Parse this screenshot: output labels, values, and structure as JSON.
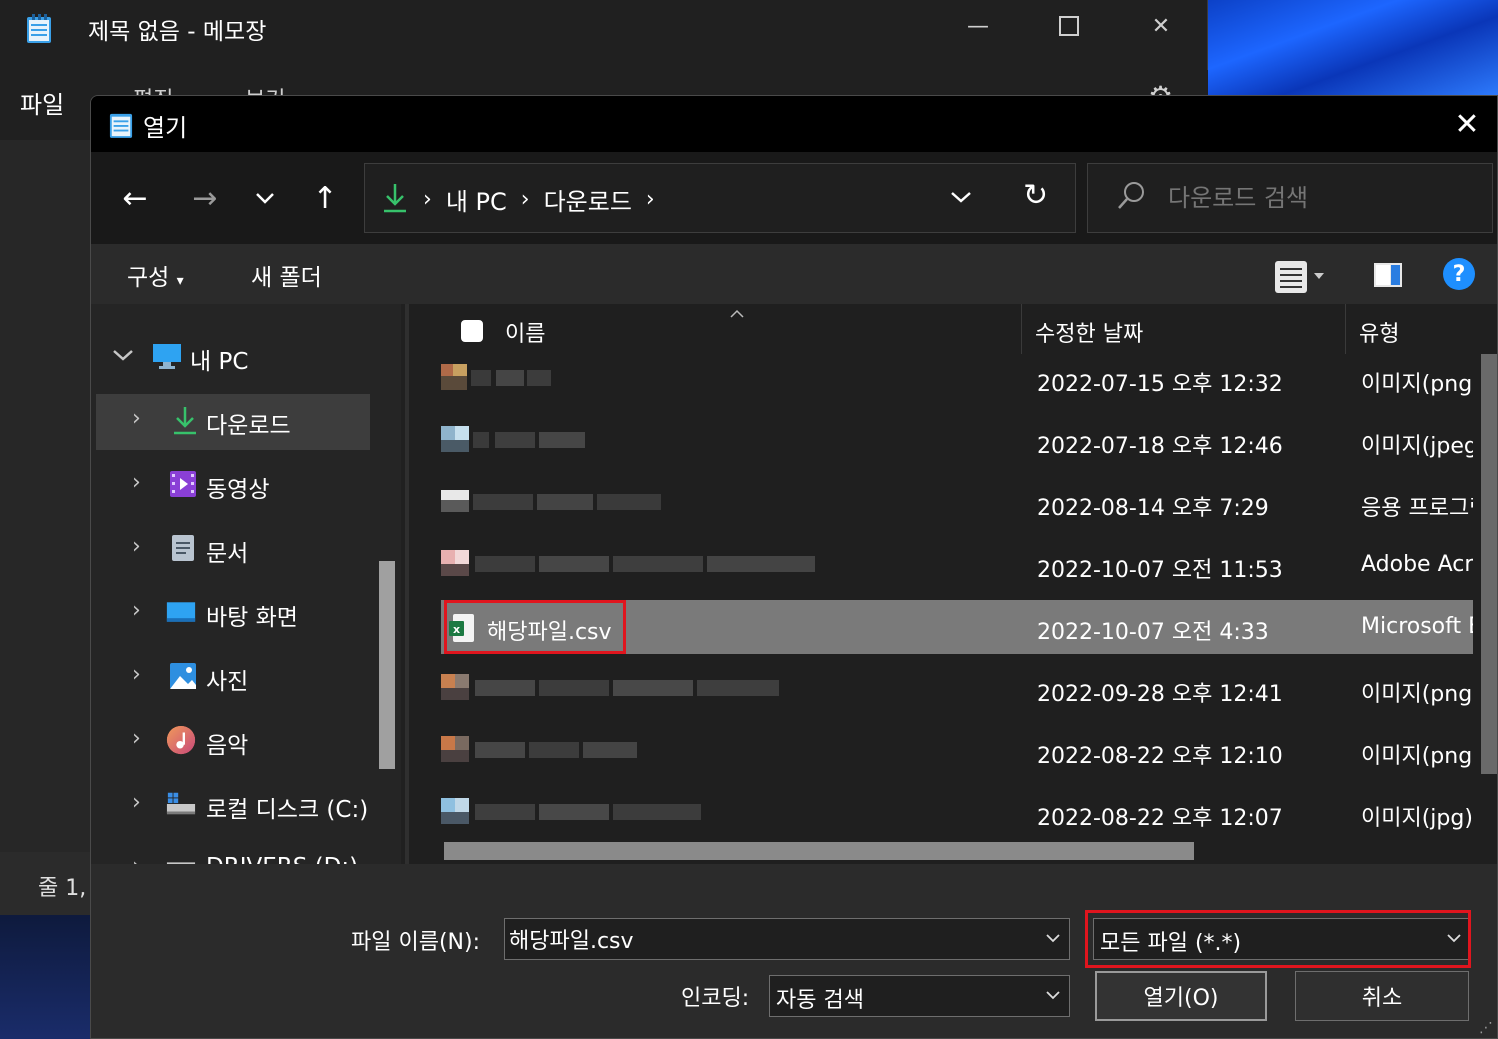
{
  "notepad": {
    "title": "제목 없음 - 메모장",
    "menu": {
      "file": "파일",
      "edit": "편집",
      "view": "보기"
    },
    "status_line": "줄 1,"
  },
  "dialog": {
    "title": "열기",
    "breadcrumbs": [
      "내 PC",
      "다운로드"
    ],
    "search_placeholder": "다운로드 검색",
    "commands": {
      "organize": "구성",
      "new_folder": "새 폴더",
      "help": "?"
    },
    "nav_tree": [
      {
        "label": "내 PC",
        "icon": "pc-icon"
      },
      {
        "label": "다운로드",
        "icon": "download-icon",
        "selected": true
      },
      {
        "label": "동영상",
        "icon": "video-icon"
      },
      {
        "label": "문서",
        "icon": "document-icon"
      },
      {
        "label": "바탕 화면",
        "icon": "desktop-icon"
      },
      {
        "label": "사진",
        "icon": "pictures-icon"
      },
      {
        "label": "음악",
        "icon": "music-icon"
      },
      {
        "label": "로컬 디스크 (C:)",
        "icon": "disk-icon"
      },
      {
        "label": "DRIVERS (D:)",
        "icon": "drive-icon"
      }
    ],
    "columns": {
      "name": "이름",
      "date": "수정한 날짜",
      "type": "유형"
    },
    "files": [
      {
        "date": "2022-07-15 오후 12:32",
        "type": "이미지(png)"
      },
      {
        "date": "2022-07-18 오후 12:46",
        "type": "이미지(jpeg)"
      },
      {
        "date": "2022-08-14 오후 7:29",
        "type": "응용 프로그램"
      },
      {
        "date": "2022-10-07 오전 11:53",
        "type": "Adobe Acrobat"
      },
      {
        "name": "해당파일.csv",
        "date": "2022-10-07 오전 4:33",
        "type": "Microsoft Excel",
        "selected": true
      },
      {
        "date": "2022-09-28 오후 12:41",
        "type": "이미지(png)"
      },
      {
        "date": "2022-08-22 오후 12:10",
        "type": "이미지(png)"
      },
      {
        "date": "2022-08-22 오후 12:07",
        "type": "이미지(jpg)"
      }
    ],
    "filename_label": "파일 이름(N):",
    "filename_value": "해당파일.csv",
    "filetype_value": "모든 파일  (*.*)",
    "encoding_label": "인코딩:",
    "encoding_value": "자동 검색",
    "open_button": "열기(O)",
    "cancel_button": "취소"
  },
  "colors": {
    "highlight_red": "#e0151e",
    "help_blue": "#1e8fff",
    "selected_row": "#7a7a7a"
  }
}
